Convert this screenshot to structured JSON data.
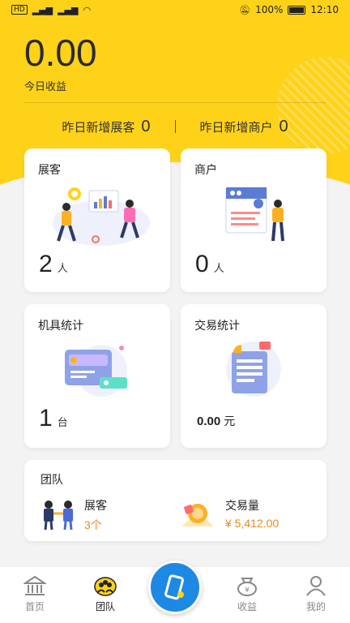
{
  "status_bar": {
    "left_text": "HD",
    "battery": "100%",
    "time": "12:10"
  },
  "today": {
    "amount": "0.00",
    "label": "今日收益"
  },
  "yesterday": {
    "new_promoters_label": "昨日新增展客",
    "new_promoters_value": "0",
    "new_merchants_label": "昨日新增商户",
    "new_merchants_value": "0"
  },
  "cards": {
    "promoters": {
      "title": "展客",
      "value": "2",
      "unit": "人"
    },
    "merchants": {
      "title": "商户",
      "value": "0",
      "unit": "人"
    },
    "devices": {
      "title": "机具统计",
      "value": "1",
      "unit": "台"
    },
    "transactions": {
      "title": "交易统计",
      "value": "0.00",
      "unit": "元"
    }
  },
  "team": {
    "title": "团队",
    "promoters_label": "展客",
    "promoters_value": "3个",
    "volume_label": "交易量",
    "volume_value": "¥ 5,412.00"
  },
  "tabbar": {
    "home": "首页",
    "team": "团队",
    "income": "收益",
    "mine": "我的"
  },
  "colors": {
    "accent": "#ffd21a",
    "fab": "#1e88e5",
    "highlight": "#e8891a"
  }
}
